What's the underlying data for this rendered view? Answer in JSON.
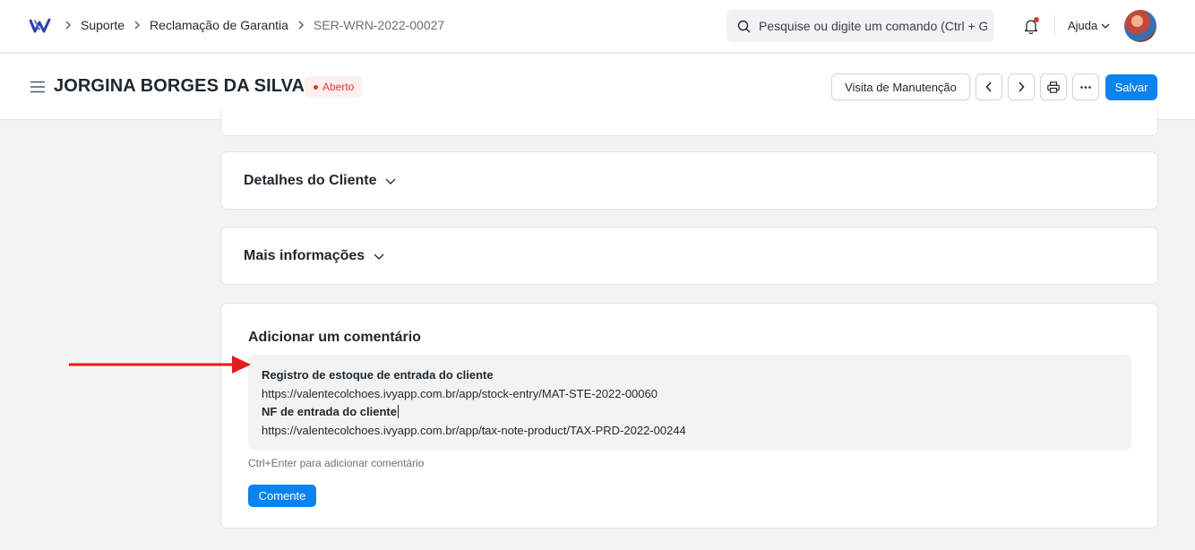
{
  "navbar": {
    "breadcrumbs": [
      "Suporte",
      "Reclamação de Garantia",
      "SER-WRN-2022-00027"
    ],
    "search_placeholder": "Pesquise ou digite um comando (Ctrl + G",
    "help_label": "Ajuda"
  },
  "page": {
    "title": "JORGINA BORGES DA SILVA",
    "status": "Aberto",
    "buttons": {
      "visit": "Visita de Manutenção",
      "save": "Salvar"
    }
  },
  "sections": {
    "customer_details": "Detalhes do Cliente",
    "more_info": "Mais informações"
  },
  "comment": {
    "title": "Adicionar um comentário",
    "lines": [
      "Registro de estoque de entrada do cliente",
      "https://valentecolchoes.ivyapp.com.br/app/stock-entry/MAT-STE-2022-00060",
      "NF de entrada do cliente",
      "https://valentecolchoes.ivyapp.com.br/app/tax-note-product/TAX-PRD-2022-00244"
    ],
    "hint": "Ctrl+Enter para adicionar comentário",
    "submit": "Comente"
  },
  "colors": {
    "primary": "#0b83ef",
    "status_red": "#e03636",
    "annotation_arrow": "#e31b1b"
  }
}
